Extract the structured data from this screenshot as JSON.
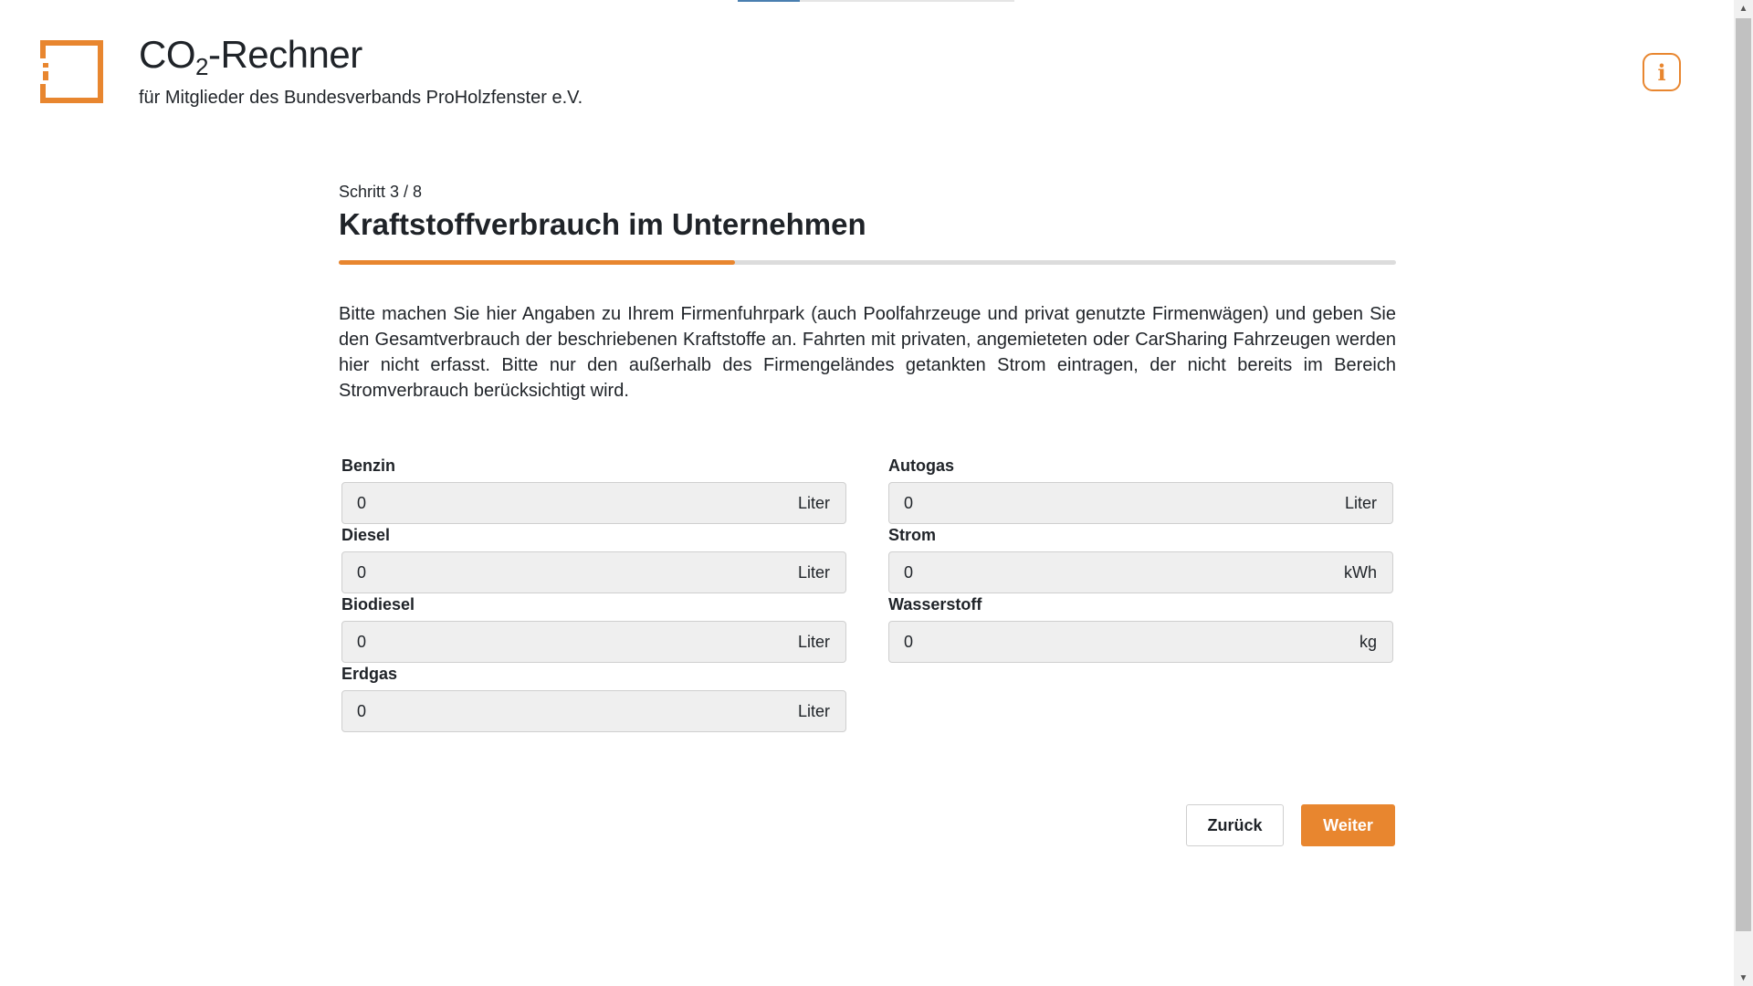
{
  "header": {
    "title_main": "CO",
    "title_sub": "2",
    "title_rest": "-Rechner",
    "subtitle": "für Mitglieder des Bundesverbands ProHolzfenster e.V.",
    "info_icon": "info-icon"
  },
  "step": {
    "label": "Schritt 3 / 8",
    "current": 3,
    "total": 8,
    "title": "Kraftstoffverbrauch im Unternehmen"
  },
  "intro": "Bitte machen Sie hier Angaben zu Ihrem Firmenfuhrpark (auch Poolfahrzeuge und privat genutzte Firmenwägen) und geben Sie den Gesamtverbrauch der beschriebenen Kraftstoffe an. Fahrten mit privaten, angemieteten oder CarSharing Fahrzeugen werden hier nicht erfasst. Bitte nur den außerhalb des Firmengeländes getankten Strom eintragen, der nicht bereits im Bereich Stromverbrauch berücksichtigt wird.",
  "fields": {
    "benzin": {
      "label": "Benzin",
      "value": "0",
      "unit": "Liter"
    },
    "diesel": {
      "label": "Diesel",
      "value": "0",
      "unit": "Liter"
    },
    "biodiesel": {
      "label": "Biodiesel",
      "value": "0",
      "unit": "Liter"
    },
    "erdgas": {
      "label": "Erdgas",
      "value": "0",
      "unit": "Liter"
    },
    "autogas": {
      "label": "Autogas",
      "value": "0",
      "unit": "Liter"
    },
    "strom": {
      "label": "Strom",
      "value": "0",
      "unit": "kWh"
    },
    "wasserstoff": {
      "label": "Wasserstoff",
      "value": "0",
      "unit": "kg"
    }
  },
  "buttons": {
    "back": "Zurück",
    "next": "Weiter"
  },
  "colors": {
    "accent": "#e8862f",
    "text": "#1f2328",
    "input_bg": "#efefef"
  }
}
